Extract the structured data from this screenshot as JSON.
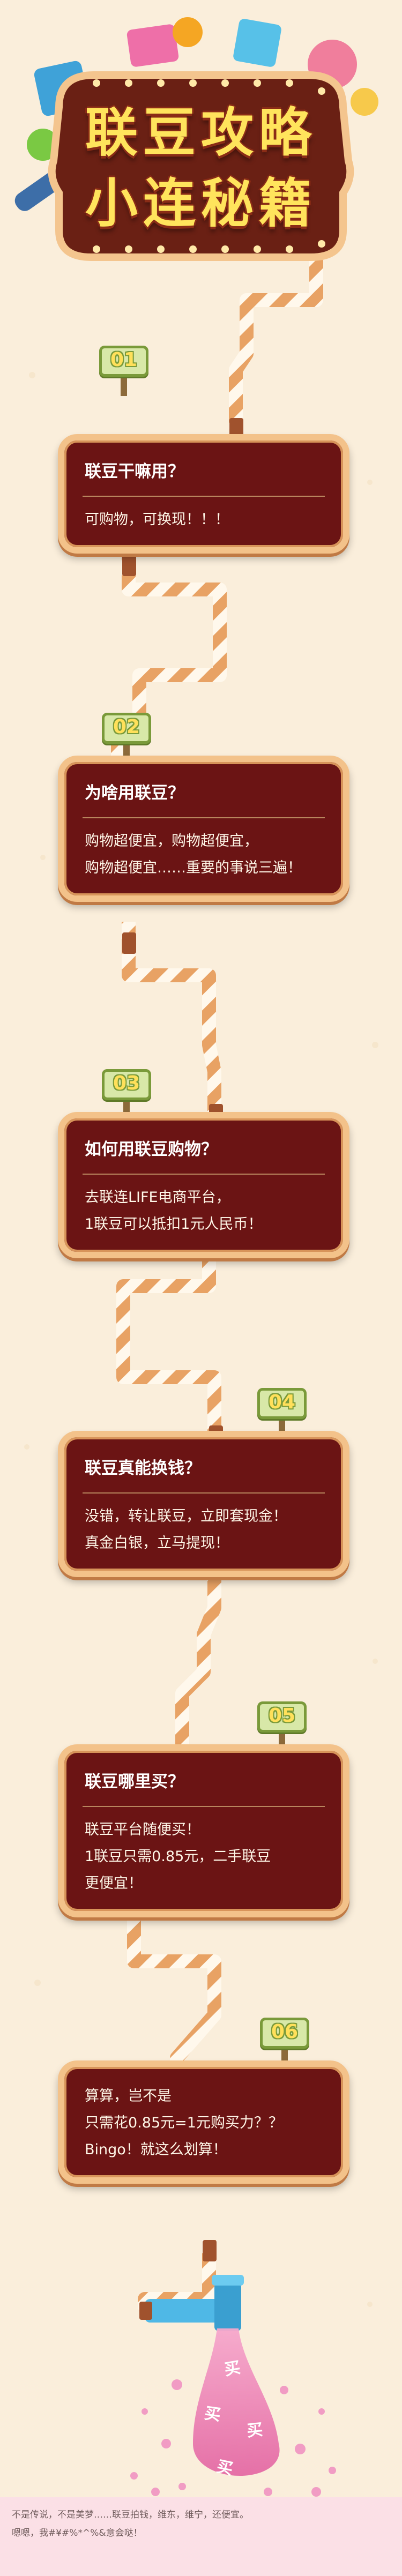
{
  "header": {
    "title_line1": "联豆攻略",
    "title_line2": "小连秘籍"
  },
  "sections": [
    {
      "number": "01",
      "question": "联豆干嘛用？",
      "answer_lines": [
        "可购物，可换现！！！"
      ]
    },
    {
      "number": "02",
      "question": "为啥用联豆？",
      "answer_lines": [
        "购物超便宜，购物超便宜，",
        "购物超便宜……重要的事说三遍！"
      ]
    },
    {
      "number": "03",
      "question": "如何用联豆购物？",
      "answer_lines": [
        "去联连LIFE电商平台，",
        "1联豆可以抵扣1元人民币！"
      ]
    },
    {
      "number": "04",
      "question": "联豆真能换钱？",
      "answer_lines": [
        "没错，转让联豆，立即套现金！",
        "真金白银，立马提现！"
      ]
    },
    {
      "number": "05",
      "question": "联豆哪里买？",
      "answer_lines": [
        "联豆平台随便买！",
        "1联豆只需0.85元，二手联豆",
        "更便宜！"
      ]
    },
    {
      "number": "06",
      "question": "算算，岂不是",
      "answer_lines": [
        "只需花0.85元=1元购买力？？",
        "Bingo！就这么划算！"
      ]
    }
  ],
  "faucet": {
    "drop_text": "买"
  },
  "footer": {
    "line1": "不是传说，不是美梦……联豆拍钱，维东，维宁，还便宜。",
    "line2": "嗯嗯，我#¥#%*^%&意会哒！"
  },
  "colors": {
    "background": "#faeedb",
    "card": "#6b1414",
    "card_border": "#f3c28a",
    "title_fill": "#ffe45c",
    "sign_green": "#7a9a3a",
    "pink_water": "#e86aa8"
  }
}
